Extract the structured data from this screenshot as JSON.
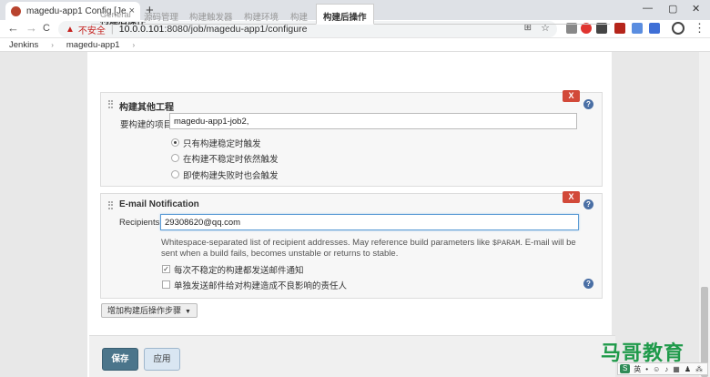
{
  "browser": {
    "tab_title": "magedu-app1 Config [Jenkins]",
    "tab_close": "×",
    "new_tab": "+",
    "window_controls": [
      "—",
      "▢",
      "✕"
    ],
    "nav": {
      "back": "←",
      "forward": "→",
      "reload": "C"
    },
    "security_label": "不安全",
    "url_host": "10.0.0.101",
    "url_rest": ":8080/job/magedu-app1/configure",
    "extension_colors": [
      "#888888",
      "#e0342f",
      "#444444",
      "#b5251b",
      "#5a8de0",
      "#3f6fd6"
    ]
  },
  "breadcrumb": {
    "items": [
      "Jenkins",
      "magedu-app1"
    ],
    "separator": "›"
  },
  "config_tabs": {
    "items": [
      "General",
      "源码管理",
      "构建触发器",
      "构建环境",
      "构建",
      "构建后操作"
    ],
    "active_index": 5
  },
  "clipped_heading": "构建后操作",
  "build_other_projects": {
    "title": "构建其他工程",
    "delete_label": "X",
    "help": "?",
    "projects_label": "要构建的项目",
    "projects_value": "magedu-app1-job2,",
    "options": [
      "只有构建稳定时触发",
      "在构建不稳定时依然触发",
      "即使构建失败时也会触发"
    ],
    "selected_index": 0
  },
  "email_notification": {
    "title": "E-mail Notification",
    "delete_label": "X",
    "help": "?",
    "recipients_label": "Recipients",
    "recipients_value": "29308620@qq.com",
    "description_pre": "Whitespace-separated list of recipient addresses. May reference build parameters like ",
    "description_code": "$PARAM",
    "description_post": ". E-mail will be sent when a build fails, becomes unstable or returns to stable.",
    "option_unstable": "每次不稳定的构建都发送邮件通知",
    "option_unstable_checked": true,
    "option_responsible": "单独发送邮件给对构建造成不良影响的责任人",
    "option_responsible_checked": false,
    "option_help": "?"
  },
  "add_step_label": "增加构建后操作步骤",
  "add_step_caret": "▼",
  "save_label": "保存",
  "apply_label": "应用",
  "watermark": "马哥教育",
  "ime": {
    "logo": "S",
    "lang": "英"
  }
}
